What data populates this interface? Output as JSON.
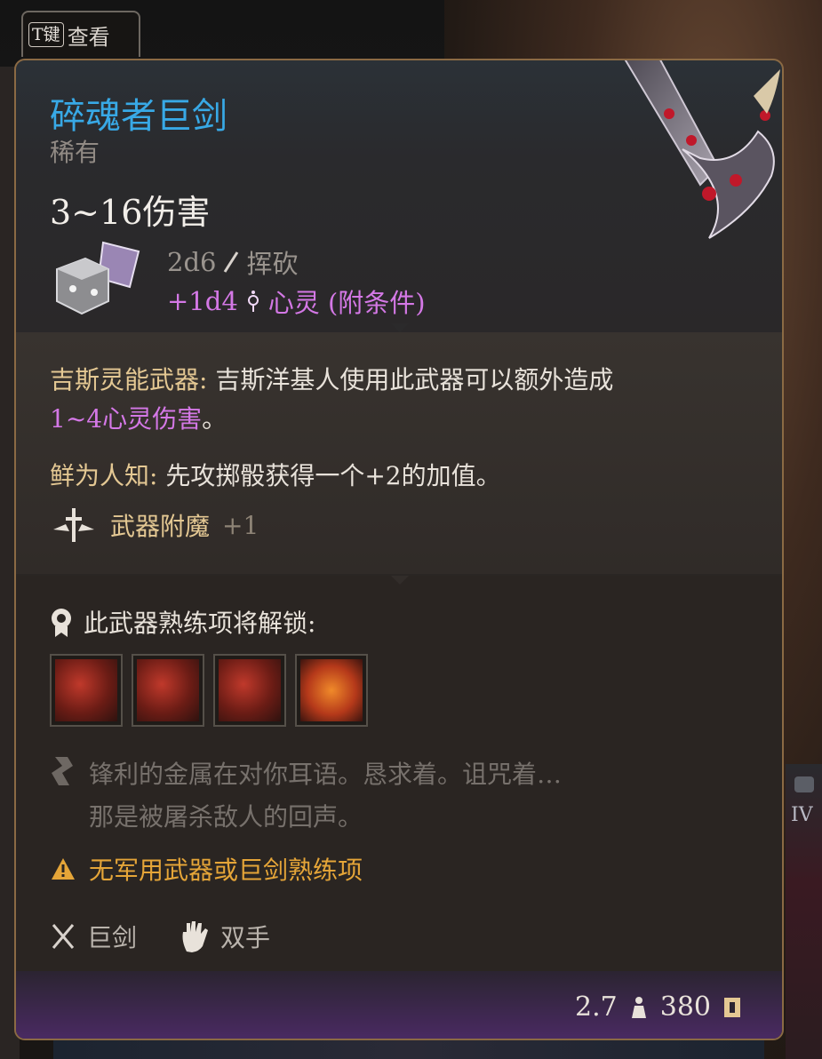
{
  "hint": {
    "key": "T键",
    "label": "查看"
  },
  "item": {
    "name": "碎魂者巨剑",
    "rarity": "稀有",
    "damage_total": "3~16伤害",
    "damage_lines": [
      {
        "dice": "2d6",
        "type": "挥砍",
        "icon": "slashing-icon",
        "color": "#9a948e"
      },
      {
        "dice": "+1d4",
        "type": "心灵 (附条件)",
        "icon": "psychic-icon",
        "color": "#d478e6"
      }
    ],
    "properties": [
      {
        "label": "吉斯灵能武器:",
        "text_plain": "吉斯洋基人使用此武器可以额外造成",
        "text_highlight": "1~4心灵伤害",
        "text_tail": "。"
      },
      {
        "label": "鲜为人知:",
        "text_plain": "先攻掷骰获得一个+2的加值。"
      }
    ],
    "enchantment": {
      "label": "武器附魔",
      "value": "+1",
      "icon": "weapon-enchant-icon"
    },
    "proficiency_unlock": {
      "title": "此武器熟练项将解锁:",
      "actions": [
        "action-icon-1",
        "action-icon-2",
        "action-icon-3",
        "action-icon-4"
      ]
    },
    "flavor": [
      "锋利的金属在对你耳语。恳求着。诅咒着…",
      "那是被屠杀敌人的回声。"
    ],
    "warning": "无军用武器或巨剑熟练项",
    "weapon_type": "巨剑",
    "handedness": "双手",
    "weight": "2.7",
    "value": "380"
  },
  "colors": {
    "name": "#38a9e6",
    "gold_label": "#e4c893",
    "psychic": "#d478e6",
    "warning": "#e5a538",
    "border": "#8b6a44"
  },
  "background": {
    "roman_numeral": "IV"
  }
}
